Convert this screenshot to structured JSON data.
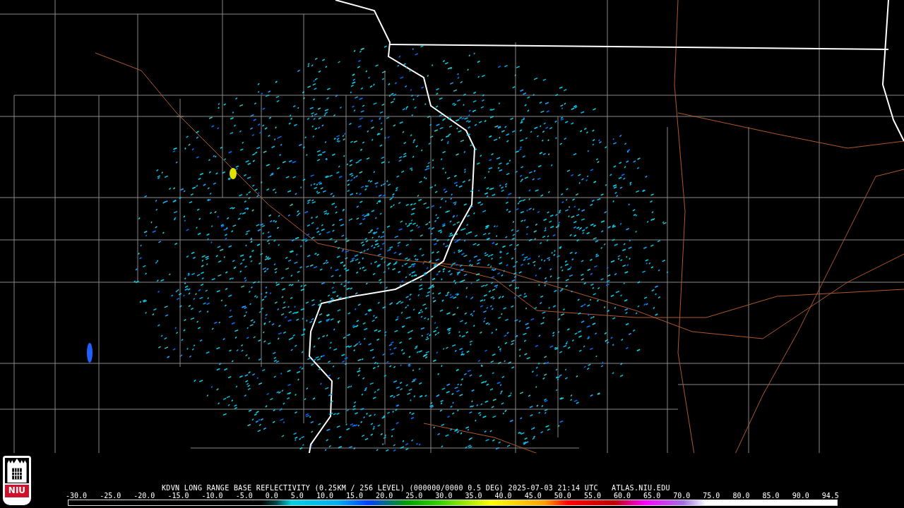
{
  "title": "KDVN LONG RANGE BASE REFLECTIVITY (0.25KM / 256 LEVEL) (000000/0000 0.5 DEG) 2025-07-03 21:14 UTC   ATLAS.NIU.EDU",
  "colorbar": {
    "ticks": [
      "-30.0",
      "-25.0",
      "-20.0",
      "-15.0",
      "-10.0",
      "-5.0",
      "0.0",
      "5.0",
      "10.0",
      "15.0",
      "20.0",
      "25.0",
      "30.0",
      "35.0",
      "40.0",
      "45.0",
      "50.0",
      "55.0",
      "60.0",
      "65.0",
      "70.0",
      "75.0",
      "80.0",
      "85.0",
      "90.0",
      "94.5"
    ]
  },
  "logo": {
    "text": "NIU"
  }
}
